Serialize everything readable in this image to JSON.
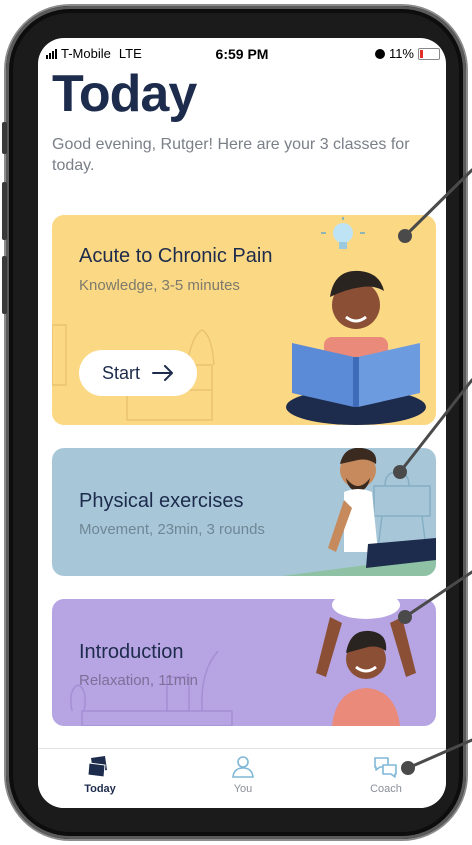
{
  "status_bar": {
    "carrier": "T-Mobile",
    "network": "LTE",
    "time": "6:59 PM",
    "battery": "11%"
  },
  "header": {
    "title": "Today",
    "subtitle": "Good evening, Rutger! Here are your 3 classes for today."
  },
  "classes": [
    {
      "title": "Acute to Chronic Pain",
      "details": "Knowledge, 3-5 minutes",
      "start_label": "Start",
      "color": "#fbd883"
    },
    {
      "title": "Physical exercises",
      "details": "Movement, 23min, 3 rounds",
      "color": "#a7c7d9"
    },
    {
      "title": "Introduction",
      "details": "Relaxation, 11min",
      "color": "#b7a4e3"
    }
  ],
  "tabbar": {
    "items": [
      {
        "label": "Today",
        "icon": "cards-icon",
        "active": true
      },
      {
        "label": "You",
        "icon": "person-icon",
        "active": false
      },
      {
        "label": "Coach",
        "icon": "chat-bubbles-icon",
        "active": false
      }
    ]
  },
  "colors": {
    "title": "#1d2b4c",
    "subtitle": "#7a7f88"
  }
}
